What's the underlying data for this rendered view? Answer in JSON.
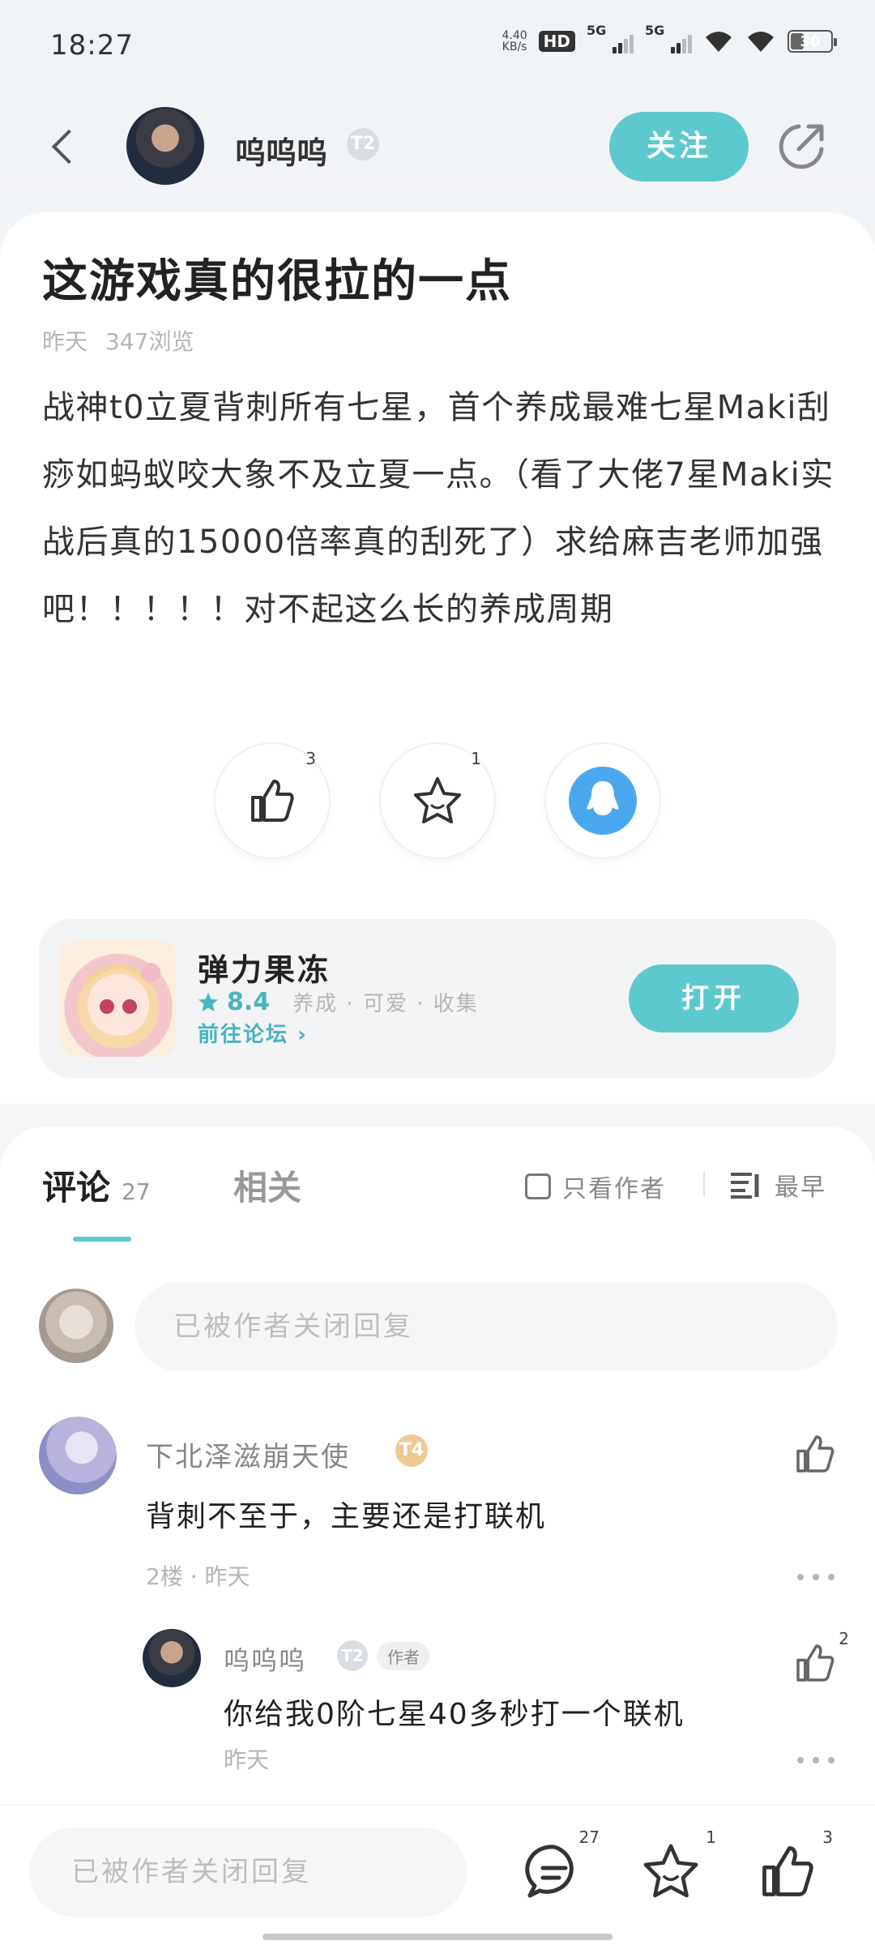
{
  "status_bar": {
    "time": "18:27",
    "net_speed": "4.40",
    "net_unit": "KB/s",
    "hd": "HD",
    "sim1": "5G",
    "sim2": "5G",
    "battery": "30"
  },
  "header": {
    "author_name": "呜呜呜",
    "level": "T2",
    "follow_label": "关注"
  },
  "post": {
    "title": "这游戏真的很拉的一点",
    "time": "昨天",
    "views": "347浏览",
    "body": "战神t0立夏背刺所有七星，首个养成最难七星Maki刮痧如蚂蚁咬大象不及立夏一点。（看了大佬7星Maki实战后真的15000倍率真的刮死了）求给麻吉老师加强吧！！！！！对不起这么长的养成周期",
    "like_count": "3",
    "fav_count": "1"
  },
  "game": {
    "name": "弹力果冻",
    "score": "8.4",
    "tags": "养成 · 可爱 · 收集",
    "forum_link": "前往论坛",
    "open_label": "打开"
  },
  "comments_section": {
    "tab_comments": "评论",
    "comment_count": "27",
    "tab_related": "相关",
    "author_only": "只看作者",
    "sort_label": "最早",
    "reply_placeholder": "已被作者关闭回复"
  },
  "comment": {
    "name": "下北泽滋崩天使",
    "level": "T4",
    "text": "背刺不至于，主要还是打联机",
    "meta": "2楼 · 昨天"
  },
  "reply": {
    "name": "呜呜呜",
    "level": "T2",
    "author_tag": "作者",
    "text": "你给我0阶七星40多秒打一个联机",
    "meta": "昨天",
    "like_count": "2"
  },
  "bottom_bar": {
    "placeholder": "已被作者关闭回复",
    "comment_count": "27",
    "fav_count": "1",
    "like_count": "3"
  }
}
